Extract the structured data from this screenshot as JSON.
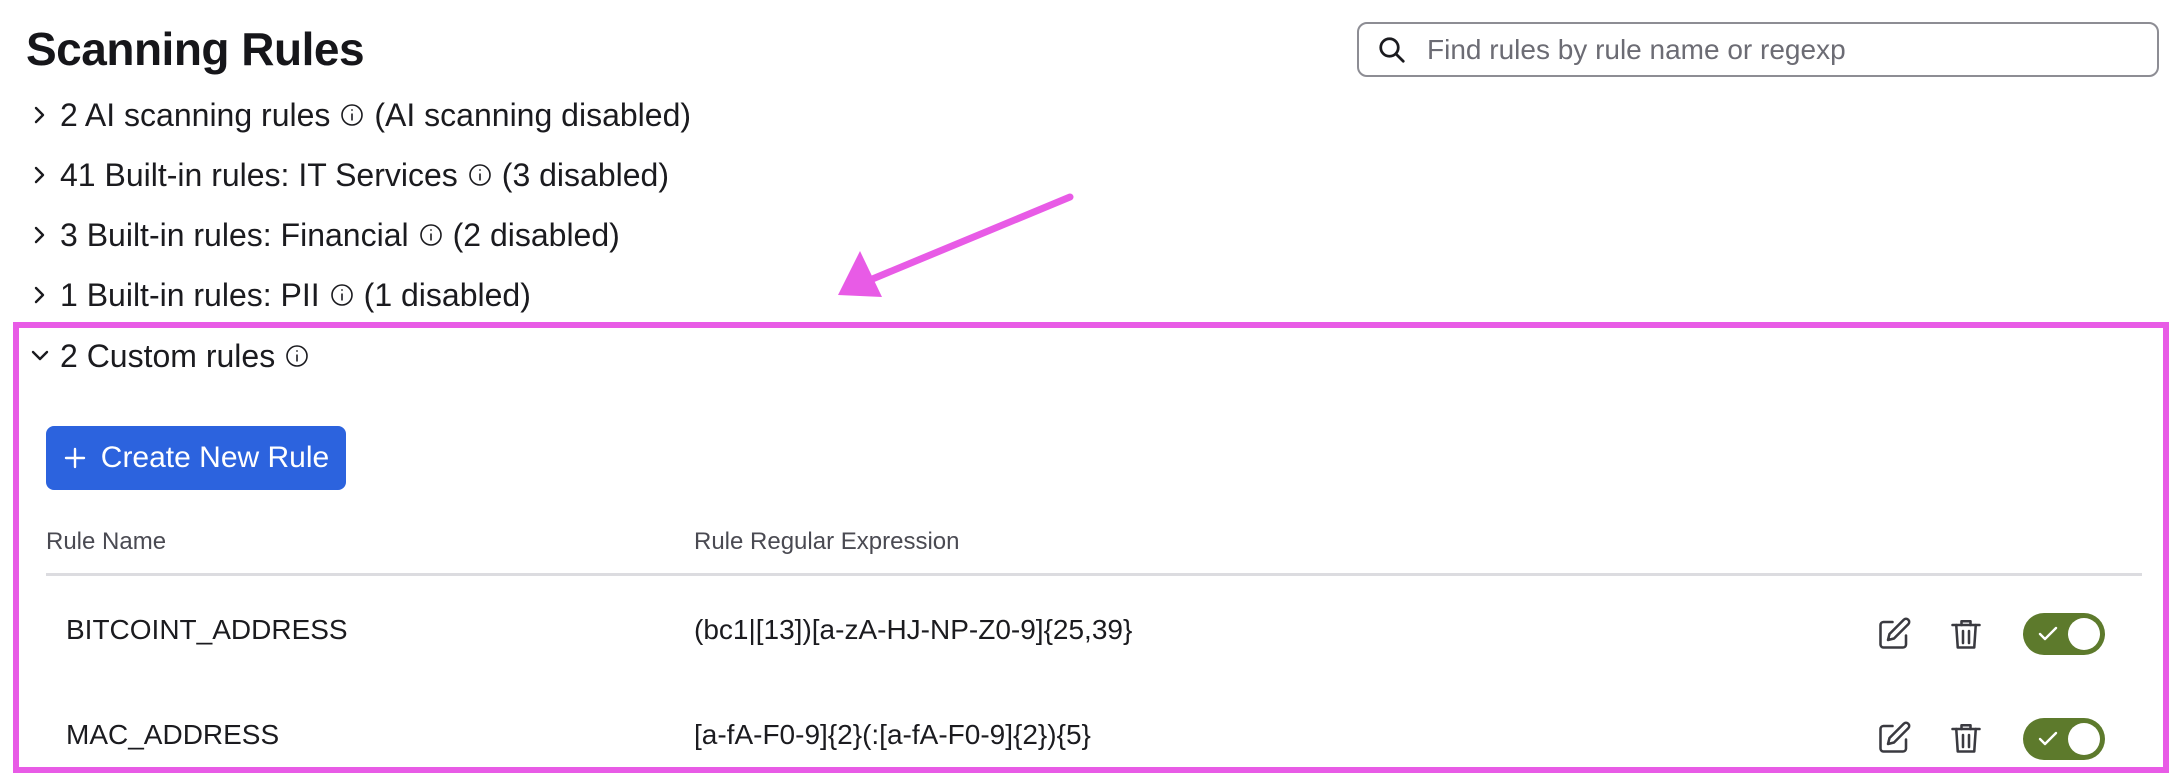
{
  "page": {
    "title": "Scanning Rules"
  },
  "search": {
    "placeholder": "Find rules by rule name or regexp",
    "value": ""
  },
  "groups": [
    {
      "label": "2 AI scanning rules",
      "status": "(AI scanning disabled)",
      "expanded": false
    },
    {
      "label": "41 Built-in rules: IT Services",
      "status": "(3 disabled)",
      "expanded": false
    },
    {
      "label": "3 Built-in rules: Financial",
      "status": "(2 disabled)",
      "expanded": false
    },
    {
      "label": "1 Built-in rules: PII",
      "status": "(1 disabled)",
      "expanded": false
    },
    {
      "label": "2 Custom rules",
      "status": "",
      "expanded": true
    }
  ],
  "custom": {
    "create_label": "Create New Rule",
    "columns": {
      "name": "Rule Name",
      "regex": "Rule Regular Expression"
    },
    "rows": [
      {
        "name": "BITCOINT_ADDRESS",
        "regex": "(bc1|[13])[a-zA-HJ-NP-Z0-9]{25,39}",
        "enabled": true
      },
      {
        "name": "MAC_ADDRESS",
        "regex": "[a-fA-F0-9]{2}(:[a-fA-F0-9]{2}){5}",
        "enabled": true
      }
    ]
  },
  "colors": {
    "primary": "#2c63de",
    "toggle_on": "#5d7a2c",
    "annotation": "#e85be6"
  },
  "icons": {
    "search": "search-icon",
    "chevron_right": "chevron-right-icon",
    "chevron_down": "chevron-down-icon",
    "info": "info-icon",
    "plus": "plus-icon",
    "edit": "edit-icon",
    "delete": "trash-icon",
    "toggle_check": "check-icon"
  }
}
